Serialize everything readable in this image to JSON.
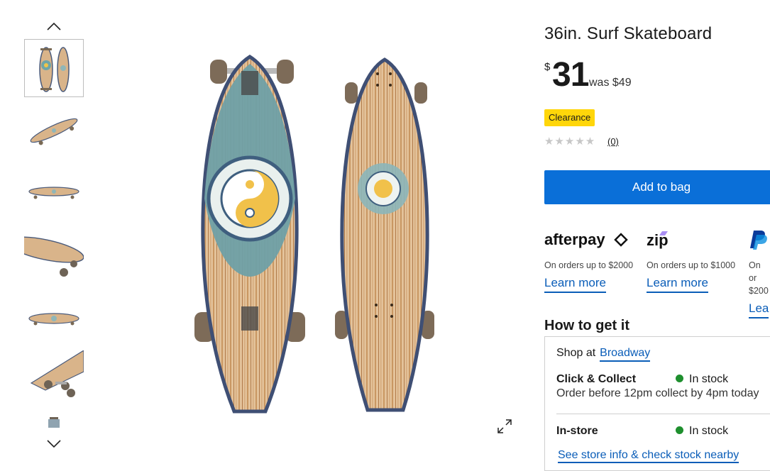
{
  "product": {
    "title": "36in. Surf Skateboard",
    "currency_symbol": "$",
    "price": "31",
    "was_price": "was $49",
    "badge": "Clearance",
    "rating_stars": "★★★★★",
    "rating_count": "(0)"
  },
  "actions": {
    "add_to_bag": "Add to bag"
  },
  "payment_options": [
    {
      "name": "afterpay",
      "desc": "On orders up to $2000",
      "link": "Learn more"
    },
    {
      "name": "zip",
      "desc": "On orders up to $1000",
      "link": "Learn more"
    },
    {
      "name": "paypal",
      "desc": "On or $200",
      "link": "Lea"
    }
  ],
  "fulfilment": {
    "heading": "How to get it",
    "shop_at_label": "Shop at",
    "store_name": "Broadway",
    "click_collect_label": "Click & Collect",
    "click_collect_status": "In stock",
    "click_collect_detail": "Order before 12pm collect by 4pm today",
    "instore_label": "In-store",
    "instore_status": "In stock",
    "store_info_link": "See store info & check stock nearby"
  },
  "colors": {
    "accent_blue": "#0a6fd8",
    "link_blue": "#0a5db8",
    "badge_yellow": "#ffd60a",
    "stock_green": "#1e8f2e"
  },
  "icons": {
    "gallery_up": "chevron-up-icon",
    "gallery_down": "chevron-down-icon",
    "expand": "expand-icon"
  }
}
